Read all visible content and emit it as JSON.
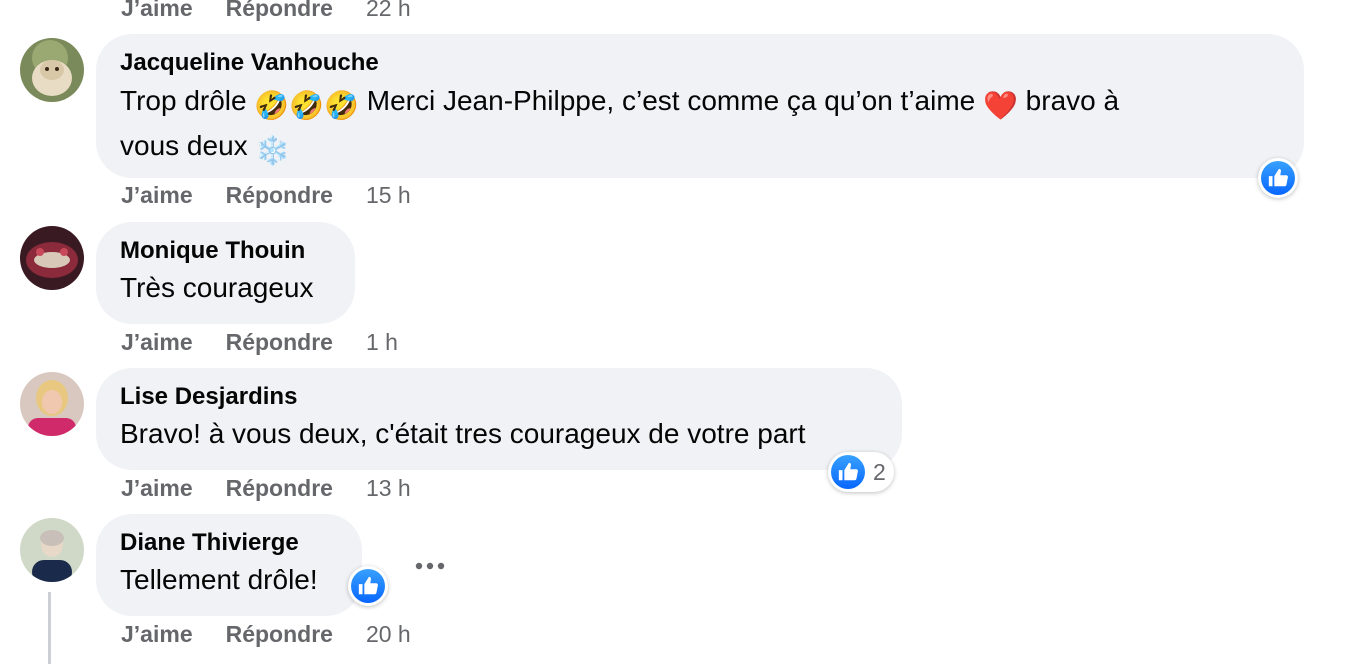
{
  "top_actions": {
    "like": "J’aime",
    "reply": "Répondre",
    "time": "22 h"
  },
  "comments": [
    {
      "author": "Jacqueline Vanhouche",
      "text_line1_a": "Trop drôle ",
      "emoji1": "🤣",
      "text_line1_b": " Merci Jean-Philppe, c’est comme ça qu’on t’aime ",
      "emoji2": "❤️",
      "text_line1_c": " bravo à",
      "text_line2": "vous deux ",
      "emoji3": "❄️",
      "like": "J’aime",
      "reply": "Répondre",
      "time": "15 h"
    },
    {
      "author": "Monique Thouin",
      "text": "Très courageux",
      "like": "J’aime",
      "reply": "Répondre",
      "time": "1 h"
    },
    {
      "author": "Lise Desjardins",
      "text": "Bravo! à vous deux, c'était tres courageux de votre part",
      "reactions_count": "2",
      "like": "J’aime",
      "reply": "Répondre",
      "time": "13 h"
    },
    {
      "author": "Diane Thivierge",
      "text": "Tellement drôle!",
      "like": "J’aime",
      "reply": "Répondre",
      "time": "20 h"
    }
  ],
  "icons": {
    "reaction": "like-thumb-icon",
    "more": "more-options-icon"
  },
  "colors": {
    "bubble": "#f0f2f5",
    "like_blue": "#0866ff",
    "meta": "#65676b"
  }
}
